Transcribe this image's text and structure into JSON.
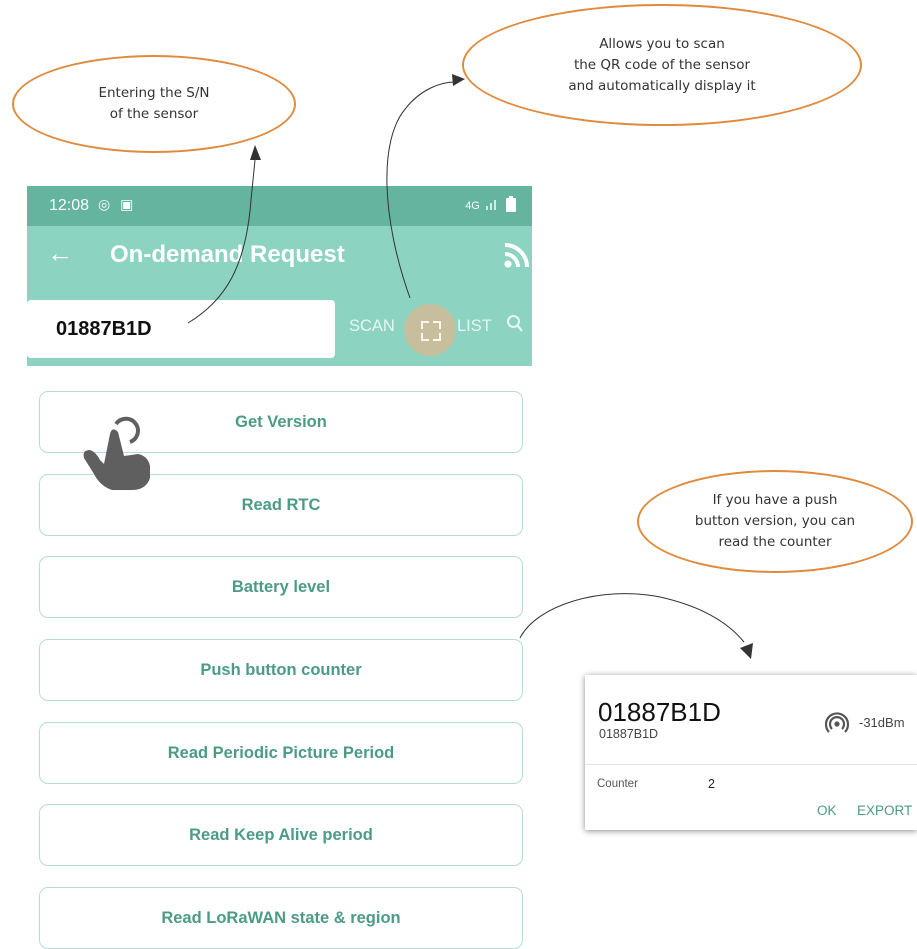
{
  "annotations": {
    "sn_callout": "Entering the S/N\nof the sensor",
    "qr_callout": "Allows you to scan\nthe QR code of the sensor\nand automatically display it",
    "push_callout": "If you have a push\nbutton version, you can\nread the counter"
  },
  "status_bar": {
    "time": "12:08",
    "left_icons": "◎ ▣",
    "network": "4G",
    "color": "#64b49f"
  },
  "app_bar": {
    "back_icon": "arrow-left-icon",
    "title": "On-demand Request",
    "rss_icon": "rss-icon",
    "color": "#8cd3c2"
  },
  "search": {
    "serial_value": "01887B1D",
    "scan_label": "SCAN",
    "list_label": "LIST"
  },
  "commands": [
    "Get Version",
    "Read RTC",
    "Battery level",
    "Push button counter",
    "Read Periodic Picture Period",
    "Read Keep Alive period",
    "Read LoRaWAN state & region"
  ],
  "dialog": {
    "title": "01887B1D",
    "subtitle": "01887B1D",
    "rssi": "-31dBm",
    "counter_label": "Counter",
    "counter_value": "2",
    "ok_label": "OK",
    "export_label": "EXPORT"
  },
  "colors": {
    "accent_text": "#4c9b86",
    "button_border": "#b7ddd3",
    "callout_border": "#e08a3c"
  }
}
